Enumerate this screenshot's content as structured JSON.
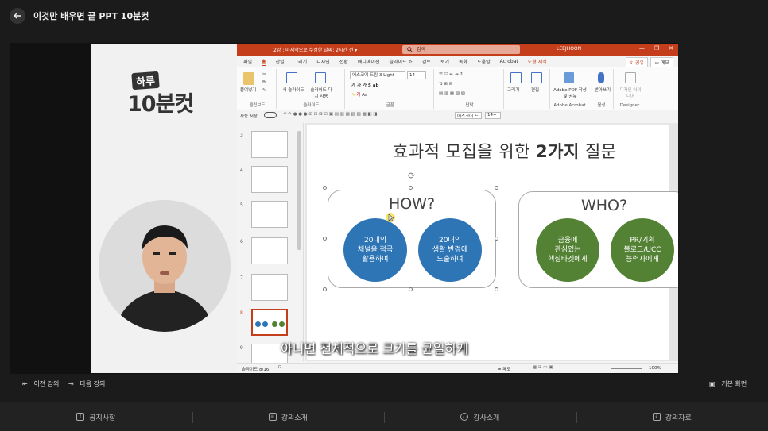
{
  "app": {
    "title": "이것만 배우면 끝 PPT 10분컷"
  },
  "lecturer_panel": {
    "logo_line1": "하루",
    "logo_line2": "10분컷"
  },
  "ppt": {
    "doc_title": "2강 : 마지막으로 수정한 날짜: 2시간 전 ▾",
    "search_placeholder": "검색",
    "user": "LEEJHOON",
    "window_controls": [
      "—",
      "❐",
      "✕"
    ],
    "tabs": [
      "파일",
      "홈",
      "삽입",
      "그리기",
      "디자인",
      "전환",
      "애니메이션",
      "슬라이드 쇼",
      "검토",
      "보기",
      "녹화",
      "도움말",
      "Acrobat",
      "도형 서식"
    ],
    "selected_tab": "홈",
    "share_label": "공유",
    "memo_label": "메모",
    "ribbon": {
      "groups": [
        "클립보드",
        "슬라이드",
        "글꼴",
        "단락",
        "",
        "Adobe Acrobat",
        "음성",
        "Designer"
      ],
      "paste": "붙여넣기",
      "new_slide": "새 슬라이드",
      "reuse_slide": "슬라이드 다시 사용",
      "font_name": "에스코어 드림 3 Light",
      "font_size": "14+",
      "draw": "그리기",
      "edit": "편집",
      "adobe_pdf": "Adobe PDF 작성 및 공유",
      "dictate": "받아쓰기",
      "designer": "디자인 아이디어"
    },
    "qat": {
      "autosave": "자동 저장",
      "font": "에스코어 드",
      "size": "14+"
    },
    "slide_numbers": [
      "3",
      "4",
      "5",
      "6",
      "7",
      "8",
      "9"
    ],
    "selected_slide": "8",
    "slide": {
      "title_pre": "효과적 모집을 위한 ",
      "title_bold": "2가지",
      "title_post": " 질문",
      "how": "HOW?",
      "who": "WHO?",
      "circles": [
        "20대의\n채널을 적극\n활용하여",
        "20대의\n생활 반경에\n노출하여",
        "금융에\n관심있는\n핵심타겟에게",
        "PR/기획\n블로그/UCC\n능력자에게"
      ],
      "colors": {
        "blue": "#2e75b6",
        "green": "#548235"
      }
    },
    "status": {
      "slide_count": "슬라이드 8/16",
      "notes": "메모",
      "zoom": "100%"
    }
  },
  "caption": "아니면 전체적으로 크기를 균일하게",
  "controls": {
    "prev": "이전 강의",
    "next": "다음 강의",
    "view": "기본 화면"
  },
  "bottom_nav": [
    "공지사항",
    "강의소개",
    "강사소개",
    "강의자료"
  ]
}
